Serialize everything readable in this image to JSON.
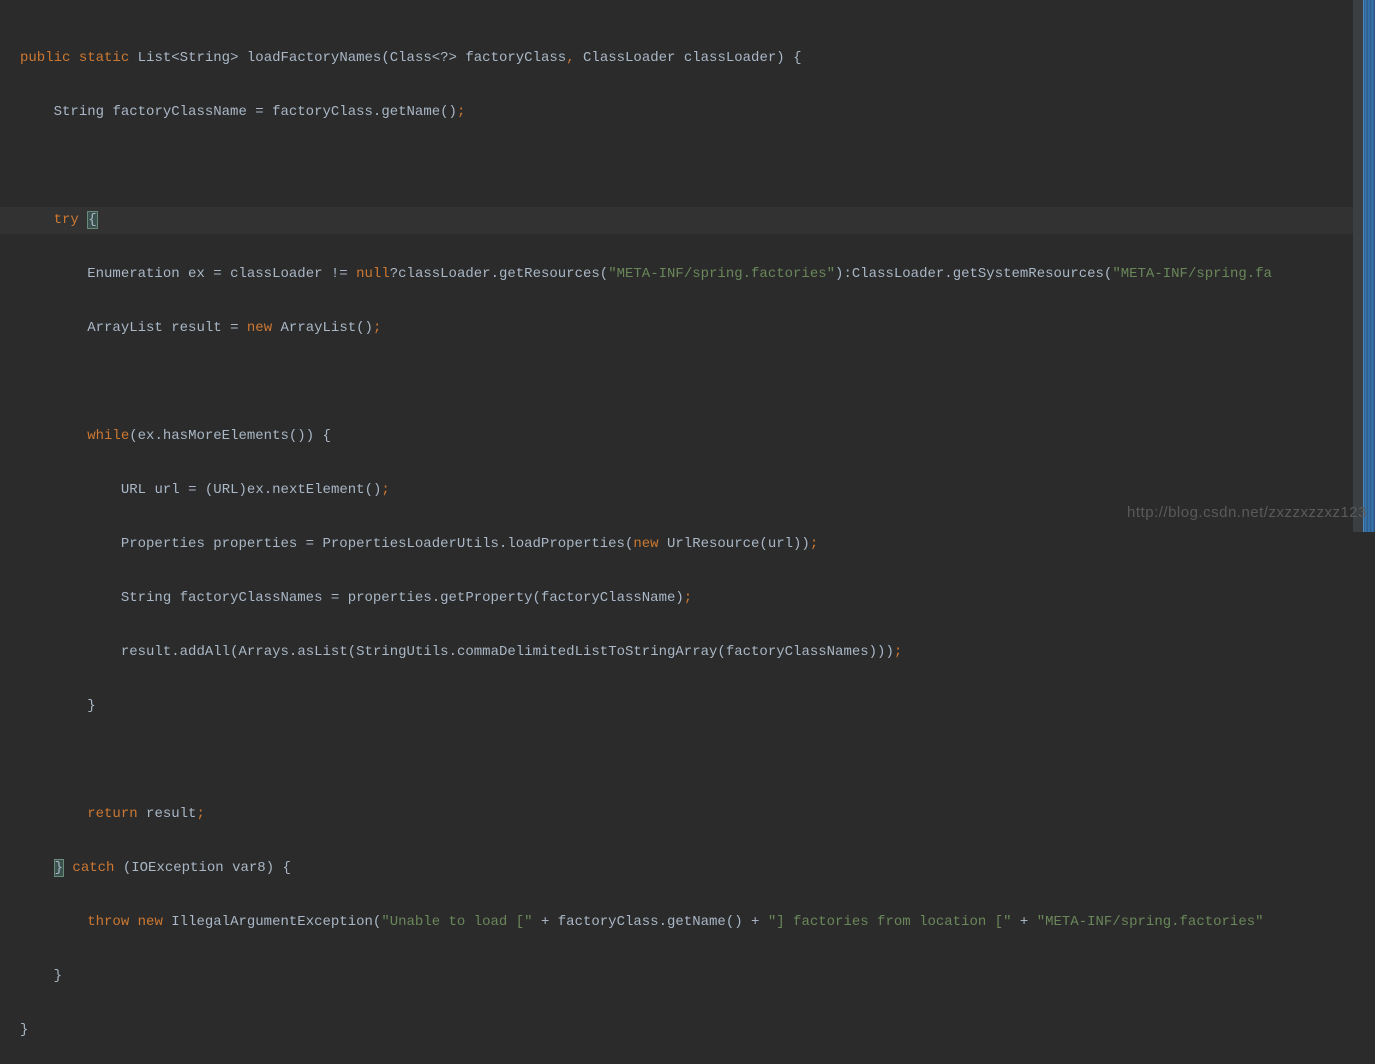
{
  "code": {
    "line1": {
      "public": "public",
      "static": "static",
      "list": "List",
      "lt": "<",
      "string_t": "String",
      "gt": ">",
      "method": "loadFactoryNames",
      "lp": "(",
      "class_t": "Class",
      "lt2": "<?>",
      "param1": "factoryClass",
      "comma": ",",
      "classloader_t": "ClassLoader",
      "param2": "classLoader",
      "rp": ")",
      "lb": "{"
    },
    "line2": {
      "indent": "    ",
      "string_t": "String",
      "var": "factoryClassName",
      "eq": "=",
      "obj": "factoryClass",
      "dot": ".",
      "call": "getName",
      "paren": "()",
      "semi": ";"
    },
    "line3": {
      "empty": ""
    },
    "line4": {
      "indent": "    ",
      "try": "try",
      "lb": "{"
    },
    "line5": {
      "indent": "        ",
      "enum_t": "Enumeration",
      "var": "ex",
      "eq": "=",
      "cl": "classLoader",
      "neq": "!=",
      "null": "null",
      "q": "?",
      "cl2": "classLoader",
      "dot": ".",
      "getres": "getResources",
      "lp": "(",
      "str1": "\"META-INF/spring.factories\"",
      "rp": ")",
      "colon": ":",
      "cL": "ClassLoader",
      "dot2": ".",
      "getsys": "getSystemResources",
      "lp2": "(",
      "str2": "\"META-INF/spring.fa"
    },
    "line6": {
      "indent": "        ",
      "al_t": "ArrayList",
      "var": "result",
      "eq": "=",
      "new": "new",
      "al2": "ArrayList",
      "paren": "()",
      "semi": ";"
    },
    "line7": {
      "empty": ""
    },
    "line8": {
      "indent": "        ",
      "while": "while",
      "lp": "(",
      "ex": "ex",
      "dot": ".",
      "hme": "hasMoreElements",
      "paren": "()",
      "rp": ")",
      "lb": "{"
    },
    "line9": {
      "indent": "            ",
      "url_t": "URL",
      "var": "url",
      "eq": "=",
      "lp": "(",
      "url_t2": "URL",
      "rp": ")",
      "ex": "ex",
      "dot": ".",
      "ne": "nextElement",
      "paren": "()",
      "semi": ";"
    },
    "line10": {
      "indent": "            ",
      "prop_t": "Properties",
      "var": "properties",
      "eq": "=",
      "plu": "PropertiesLoaderUtils",
      "dot": ".",
      "lp": "loadProperties",
      "lp2": "(",
      "new": "new",
      "ur": "UrlResource",
      "lp3": "(",
      "url": "url",
      "rp": "))",
      "semi": ";"
    },
    "line11": {
      "indent": "            ",
      "str_t": "String",
      "var": "factoryClassNames",
      "eq": "=",
      "props": "properties",
      "dot": ".",
      "gp": "getProperty",
      "lp": "(",
      "fcn": "factoryClassName",
      "rp": ")",
      "semi": ";"
    },
    "line12": {
      "indent": "            ",
      "res": "result",
      "dot": ".",
      "aa": "addAll",
      "lp": "(",
      "arr": "Arrays",
      "dot2": ".",
      "al": "asList",
      "lp2": "(",
      "su": "StringUtils",
      "dot3": ".",
      "cd": "commaDelimitedListToStringArray",
      "lp3": "(",
      "fcn": "factoryClassNames",
      "rp": ")))",
      "semi": ";"
    },
    "line13": {
      "indent": "        ",
      "rb": "}"
    },
    "line14": {
      "empty": ""
    },
    "line15": {
      "indent": "        ",
      "return": "return",
      "res": "result",
      "semi": ";"
    },
    "line16": {
      "indent": "    ",
      "rb": "}",
      "catch": "catch",
      "lp": "(",
      "ioe": "IOException",
      "var": "var8",
      "rp": ")",
      "lb": "{"
    },
    "line17": {
      "indent": "        ",
      "throw": "throw",
      "new": "new",
      "iae": "IllegalArgumentException",
      "lp": "(",
      "str1": "\"Unable to load [\"",
      "plus": "+",
      "fc": "factoryClass",
      "dot": ".",
      "gn": "getName",
      "paren": "()",
      "plus2": "+",
      "str2": "\"] factories from location [\"",
      "plus3": "+",
      "str3": "\"META-INF/spring.factories\""
    },
    "line18": {
      "indent": "    ",
      "rb": "}"
    },
    "line19": {
      "rb": "}"
    }
  },
  "watermark": "http://blog.csdn.net/zxzzxzzxz123"
}
